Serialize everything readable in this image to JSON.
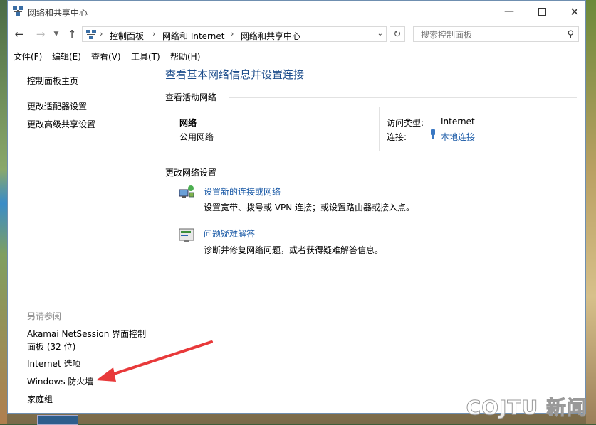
{
  "window": {
    "title": "网络和共享中心"
  },
  "address_bar": {
    "crumbs": [
      "控制面板",
      "网络和 Internet",
      "网络和共享中心"
    ],
    "search_placeholder": "搜索控制面板"
  },
  "menu": [
    "文件(F)",
    "编辑(E)",
    "查看(V)",
    "工具(T)",
    "帮助(H)"
  ],
  "sidebar": {
    "links": [
      "控制面板主页",
      "更改适配器设置",
      "更改高级共享设置"
    ],
    "see_also_title": "另请参阅",
    "see_also": [
      "Akamai NetSession 界面控制",
      "面板 (32 位)",
      "Internet 选项",
      "Windows 防火墙",
      "家庭组"
    ]
  },
  "main": {
    "heading": "查看基本网络信息并设置连接",
    "active_networks_title": "查看活动网络",
    "network_name": "网络",
    "network_type": "公用网络",
    "access_type_label": "访问类型:",
    "access_type_value": "Internet",
    "connection_label": "连接:",
    "connection_value": "本地连接",
    "change_settings_title": "更改网络设置",
    "tasks": [
      {
        "title": "设置新的连接或网络",
        "desc": "设置宽带、拨号或 VPN 连接；或设置路由器或接入点。",
        "icon": "network-setup-icon"
      },
      {
        "title": "问题疑难解答",
        "desc": "诊断并修复网络问题，或者获得疑难解答信息。",
        "icon": "troubleshoot-icon"
      }
    ]
  },
  "watermark": "COJTU 新闻",
  "colors": {
    "link": "#1d5ca8",
    "heading": "#1e4e8c",
    "annotation_arrow": "#e8393a"
  }
}
